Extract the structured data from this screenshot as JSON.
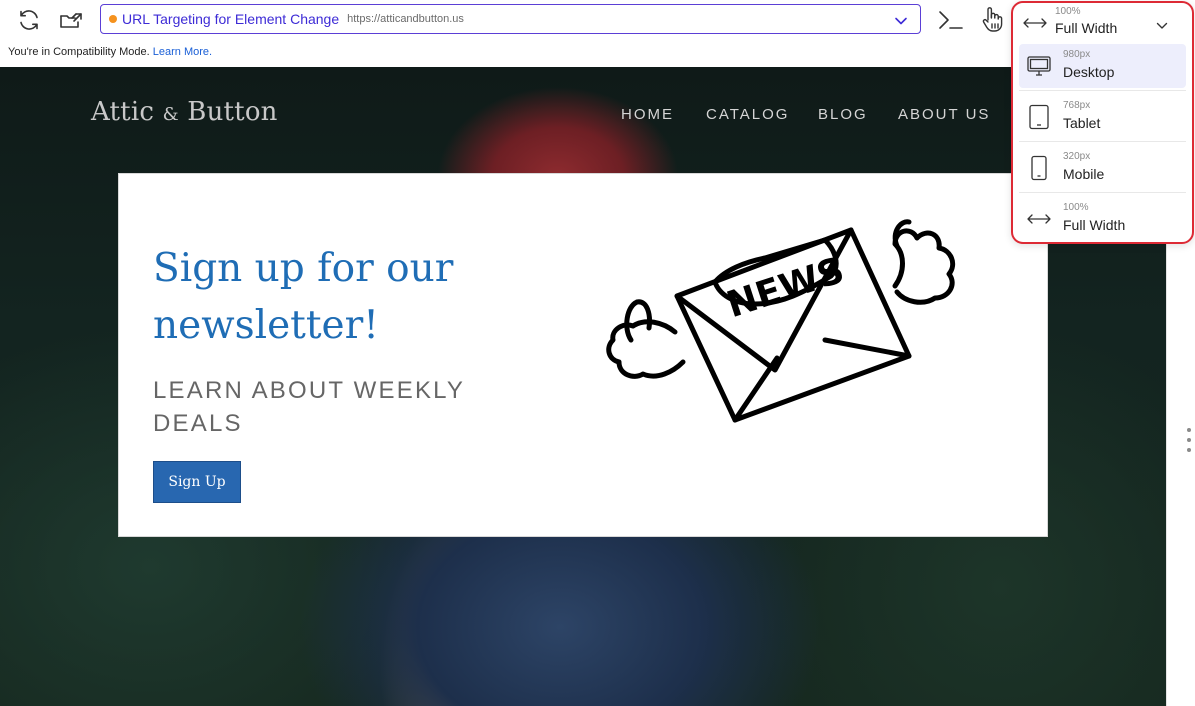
{
  "toolbar": {
    "experiment_name": "URL Targeting for Element Change",
    "url": "https://atticandbutton.us",
    "status_color": "#f5921e",
    "accent_color": "#5b3fd6"
  },
  "compat_banner": {
    "text": "You're in Compatibility Mode.",
    "link": "Learn More."
  },
  "site": {
    "logo_main": "Attic",
    "logo_amp": "&",
    "logo_end": "Button",
    "nav": [
      "HOME",
      "CATALOG",
      "BLOG",
      "ABOUT US"
    ],
    "card": {
      "title": "Sign up for our newsletter!",
      "subtitle": "LEARN ABOUT WEEKLY DEALS",
      "button": "Sign Up",
      "art_text": "NEWS"
    }
  },
  "viewport": {
    "current": {
      "percent": "100%",
      "label": "Full Width"
    },
    "options": [
      {
        "size": "980px",
        "label": "Desktop",
        "icon": "desktop-icon",
        "selected": true
      },
      {
        "size": "768px",
        "label": "Tablet",
        "icon": "tablet-icon",
        "selected": false
      },
      {
        "size": "320px",
        "label": "Mobile",
        "icon": "mobile-icon",
        "selected": false
      },
      {
        "size": "100%",
        "label": "Full Width",
        "icon": "full-width-icon",
        "selected": false
      }
    ],
    "highlight_color": "#dd2a35"
  }
}
